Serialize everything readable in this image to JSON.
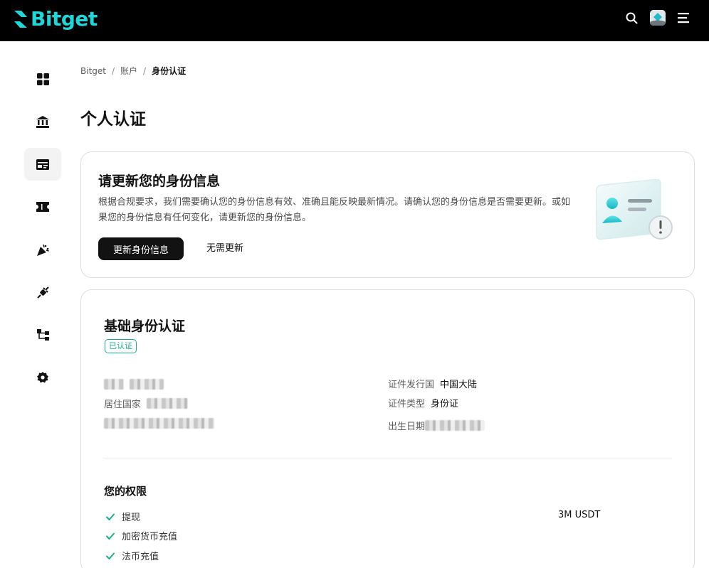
{
  "brand": {
    "name": "Bitget",
    "accent": "#1fd6d9"
  },
  "topbar": {
    "icons": [
      "search-icon",
      "avatar",
      "menu-icon"
    ]
  },
  "sidebar": {
    "items": [
      {
        "icon": "dashboard-icon",
        "active": false
      },
      {
        "icon": "bank-icon",
        "active": false
      },
      {
        "icon": "id-card-icon",
        "active": true
      },
      {
        "icon": "ticket-icon",
        "active": false
      },
      {
        "icon": "party-popper-icon",
        "active": false
      },
      {
        "icon": "plug-icon",
        "active": false
      },
      {
        "icon": "hierarchy-icon",
        "active": false
      },
      {
        "icon": "settings-icon",
        "active": false
      }
    ]
  },
  "breadcrumb": {
    "items": [
      "Bitget",
      "账户",
      "身份认证"
    ]
  },
  "page": {
    "title": "个人认证"
  },
  "update_card": {
    "title": "请更新您的身份信息",
    "description": "根据合规要求，我们需要确认您的身份信息有效、准确且能反映最新情况。请确认您的身份信息是否需要更新。或如果您的身份信息有任何变化，请更新您的身份信息。",
    "primary_button": "更新身份信息",
    "secondary_button": "无需更新"
  },
  "basic_card": {
    "title": "基础身份认证",
    "badge": "已认证",
    "fields_left": {
      "residence_label": "居住国家"
    },
    "fields_right": {
      "issuer_label": "证件发行国",
      "issuer_value": "中国大陆",
      "doc_type_label": "证件类型",
      "doc_type_value": "身份证",
      "birth_label": "出生日期"
    },
    "permissions": {
      "title": "您的权限",
      "items": [
        "提现",
        "加密货币充值",
        "法币充值"
      ],
      "withdraw_limit": "3M USDT"
    },
    "status_color": "#18b08a"
  }
}
